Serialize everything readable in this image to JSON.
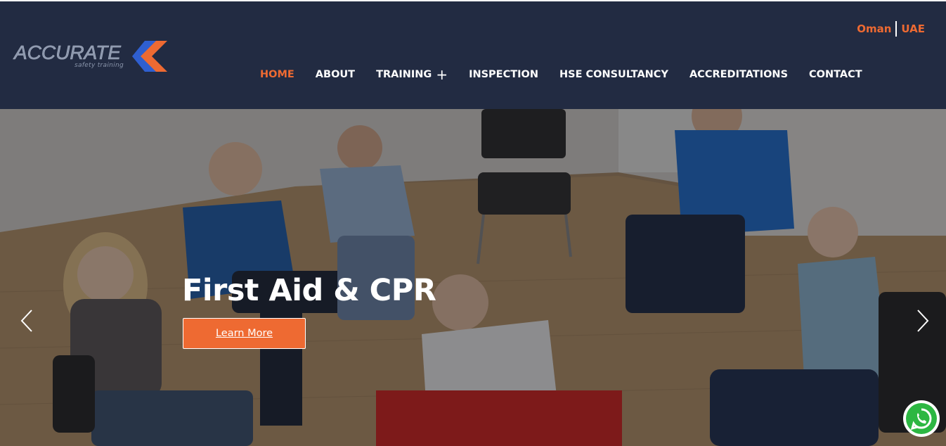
{
  "brand": {
    "logo_word": "ACCURATE",
    "logo_tagline": "safety training",
    "accent": "#ee6a32",
    "secondary": "#2f5fd0",
    "header_bg": "#222b42"
  },
  "region": {
    "links": [
      "Oman",
      "UAE"
    ]
  },
  "nav": {
    "items": [
      {
        "label": "HOME",
        "active": true
      },
      {
        "label": "ABOUT"
      },
      {
        "label": "TRAINING",
        "has_submenu": true
      },
      {
        "label": "INSPECTION"
      },
      {
        "label": "HSE CONSULTANCY"
      },
      {
        "label": "ACCREDITATIONS"
      },
      {
        "label": "CONTACT"
      }
    ]
  },
  "hero": {
    "title": "First Aid & CPR",
    "cta_label": "Learn More",
    "prev_icon": "chevron-left-icon",
    "next_icon": "chevron-right-icon"
  },
  "floating": {
    "icon": "whatsapp-icon",
    "color": "#2cb742"
  }
}
